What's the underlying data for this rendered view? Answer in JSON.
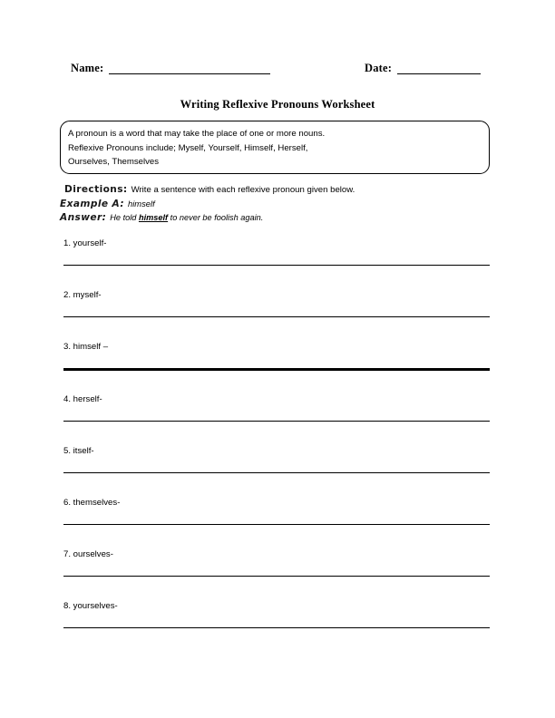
{
  "page": {
    "background": "#ffffff",
    "ink": "#000000"
  },
  "header": {
    "name_label": "Name:",
    "name_value": "",
    "date_label": "Date:",
    "date_value": ""
  },
  "title": "Writing Reflexive Pronouns Worksheet",
  "definition_box": {
    "lines": [
      "A pronoun is a word that may take the place of one or more nouns.",
      "Reflexive Pronouns include; Myself, Yourself, Himself, Herself,",
      "Ourselves, Themselves"
    ]
  },
  "directions": {
    "directions_label": "Directions:",
    "directions_text": "Write a sentence with each reflexive pronoun given below.",
    "example_label": "Example A:",
    "example_text": "himself",
    "answer_label": "Answer:",
    "answer_prefix": "He told ",
    "answer_keyword": "himself",
    "answer_suffix": " to never be foolish again."
  },
  "questions": [
    {
      "number": "1.",
      "prompt": "1. yourself-",
      "line_weight": "thin"
    },
    {
      "number": "2.",
      "prompt": "2. myself-",
      "line_weight": "thin"
    },
    {
      "number": "3.",
      "prompt": "3. himself –",
      "line_weight": "thick"
    },
    {
      "number": "4.",
      "prompt": "4. herself-",
      "line_weight": "thin"
    },
    {
      "number": "5.",
      "prompt": "5. itself-",
      "line_weight": "thin"
    },
    {
      "number": "6.",
      "prompt": "6. themselves-",
      "line_weight": "thin"
    },
    {
      "number": "7.",
      "prompt": "7. ourselves-",
      "line_weight": "thin"
    },
    {
      "number": "8.",
      "prompt": "8. yourselves-",
      "line_weight": "thin"
    }
  ]
}
